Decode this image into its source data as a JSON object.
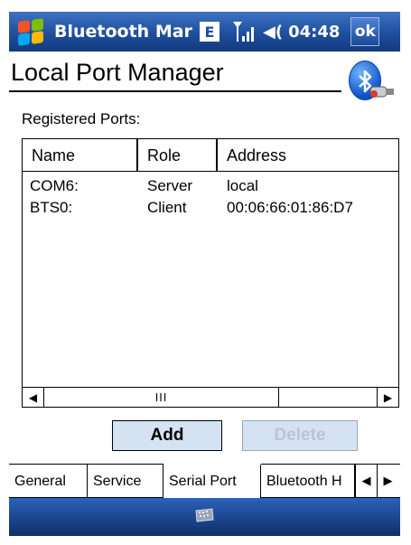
{
  "titlebar": {
    "app_title": "Bluetooth Mar",
    "edge_badge": "E",
    "time": "04:48",
    "ok_label": "ok",
    "icons": [
      "windows-start-icon",
      "signal-strength-icon",
      "speaker-icon"
    ]
  },
  "header": {
    "title": "Local Port Manager",
    "icon": "bluetooth-icon"
  },
  "registered_label": "Registered Ports:",
  "table": {
    "columns": [
      "Name",
      "Role",
      "Address"
    ],
    "rows": [
      {
        "name": "COM6:",
        "role": "Server",
        "address": "local"
      },
      {
        "name": "BTS0:",
        "role": "Client",
        "address": "00:06:66:01:86:D7"
      }
    ],
    "scroll_thumb_glyph": "III"
  },
  "buttons": {
    "add": "Add",
    "delete": "Delete"
  },
  "tabs": [
    {
      "label": "General",
      "active": false
    },
    {
      "label": "Service",
      "active": false
    },
    {
      "label": "Serial Port",
      "active": true
    },
    {
      "label": "Bluetooth H",
      "active": false
    }
  ],
  "colors": {
    "titlebar": "#1f4f9e",
    "button_bg": "#d5e2f2",
    "disabled_text": "#b9c5d6"
  }
}
